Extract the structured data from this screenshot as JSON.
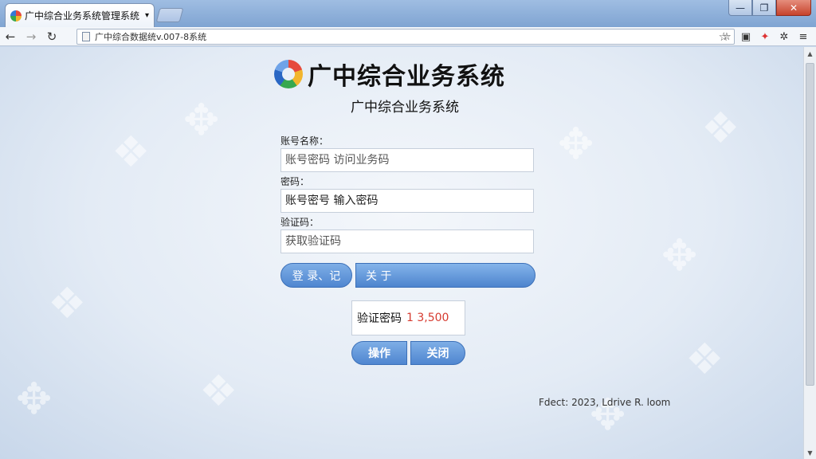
{
  "browser": {
    "tab_title": "广中综合业务系统管理系统",
    "tab_arrow": "▾",
    "url": "广中综合数据统v.007-8系统",
    "window_controls": {
      "minimize": "—",
      "maximize": "❐",
      "close": "✕"
    },
    "nav": {
      "back": "←",
      "forward": "→",
      "reload": "↻"
    },
    "right_tools": {
      "star1": "☆",
      "star2": "☆",
      "menu": "≡"
    }
  },
  "page": {
    "logo_title": "广中综合业务系统",
    "subtitle": "广中综合业务系统",
    "fields": [
      {
        "label": "账号名称：",
        "value": "账号密码 访问业务码"
      },
      {
        "label": "密码：",
        "value": "账号密号 输入密码"
      },
      {
        "label": "验证码：",
        "value": "获取验证码"
      }
    ],
    "buttons": {
      "left": "登 录、记",
      "right": "关 于"
    },
    "verify": {
      "label": "验证密码",
      "value": "1 3,500"
    },
    "action_buttons": {
      "first": "操作",
      "second": "关闭"
    },
    "footer": "Fdect: 2023, Ldrive R. loom"
  }
}
